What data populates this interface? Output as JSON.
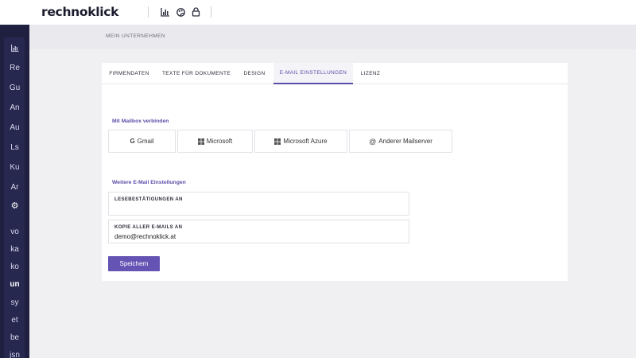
{
  "app": {
    "logo": "rechnoklick"
  },
  "header_icons": [
    {
      "name": "chart-icon"
    },
    {
      "name": "palette-icon"
    },
    {
      "name": "lock-icon"
    }
  ],
  "sidebar": {
    "top_icon": "chart-icon",
    "items": [
      {
        "label": "Re"
      },
      {
        "label": "Gu"
      },
      {
        "label": "An"
      },
      {
        "label": "Au"
      },
      {
        "label": "Ls"
      },
      {
        "label": "Ku"
      },
      {
        "label": "Ar"
      }
    ],
    "settings_icon": "gear-icon",
    "items2": [
      {
        "label": "vo"
      },
      {
        "label": "ka"
      },
      {
        "label": "ko"
      },
      {
        "label": "un",
        "active": true
      },
      {
        "label": "sy"
      },
      {
        "label": "et"
      },
      {
        "label": "be"
      },
      {
        "label": "jsn"
      }
    ]
  },
  "breadcrumb": "MEIN UNTERNEHMEN",
  "tabs": [
    {
      "label": "FIRMENDATEN"
    },
    {
      "label": "TEXTE FÜR DOKUMENTE"
    },
    {
      "label": "DESIGN"
    },
    {
      "label": "E-MAIL EINSTELLUNGEN",
      "active": true
    },
    {
      "label": "LIZENZ"
    }
  ],
  "mailbox": {
    "title": "Mit Mailbox verbinden",
    "buttons": [
      {
        "label": "Gmail",
        "icon": "google-icon"
      },
      {
        "label": "Microsoft",
        "icon": "windows-icon"
      },
      {
        "label": "Microsoft Azure",
        "icon": "windows-icon"
      },
      {
        "label": "Anderer Mailserver",
        "icon": "at-icon"
      }
    ]
  },
  "settings": {
    "title": "Weitere E-Mail Einstellungen",
    "read_receipts_label": "LESEBESTÄTIGUNGEN AN",
    "read_receipts_value": "",
    "copy_label": "KOPIE ALLER E-MAILS AN",
    "copy_value": "demo@rechnoklick.at"
  },
  "save_label": "Speichern",
  "colors": {
    "accent": "#5a4fa6",
    "button": "#6554b4",
    "sidebar": "#1f2040",
    "band": "#e9e9ee",
    "background": "#f0f0f3"
  }
}
